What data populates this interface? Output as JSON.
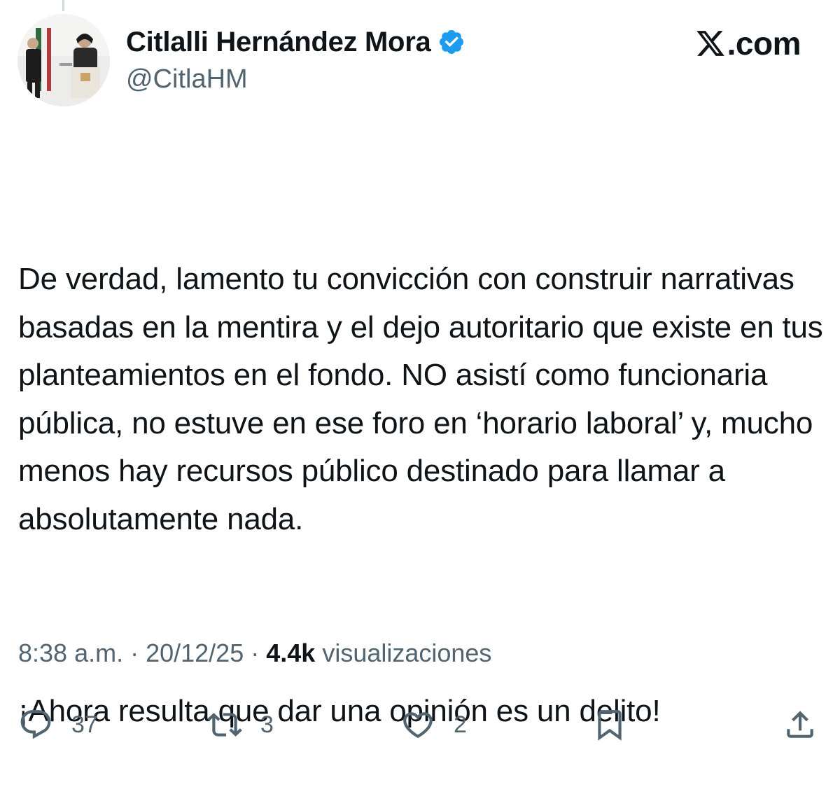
{
  "author": {
    "display_name": "Citlalli Hernández Mora",
    "handle": "@CitlaHM",
    "verified": true
  },
  "brand": {
    "text": ".com"
  },
  "tweet": {
    "paragraph_1": "De verdad, lamento tu convicción con construir narrativas basadas en la mentira y el dejo autoritario que existe en tus planteamientos en el fondo. NO asistí como funcionaria pública, no estuve en ese foro en ‘horario laboral’ y, mucho menos hay recursos público destinado para llamar a absolutamente nada.",
    "paragraph_2": "¡Ahora resulta que dar una opinión es un delito!"
  },
  "meta": {
    "time": "8:38 a.m.",
    "separator": " · ",
    "date": "20/12/25",
    "views_count": "4.4k",
    "views_label": " visualizaciones"
  },
  "actions": {
    "reply_count": "37",
    "repost_count": "3",
    "like_count": "2"
  },
  "colors": {
    "text_primary": "#0f1419",
    "text_secondary": "#536471",
    "verified_blue": "#1d9bf0"
  },
  "icons": [
    "verified-badge-icon",
    "x-logo-icon",
    "reply-icon",
    "repost-icon",
    "like-icon",
    "bookmark-icon",
    "share-icon"
  ]
}
